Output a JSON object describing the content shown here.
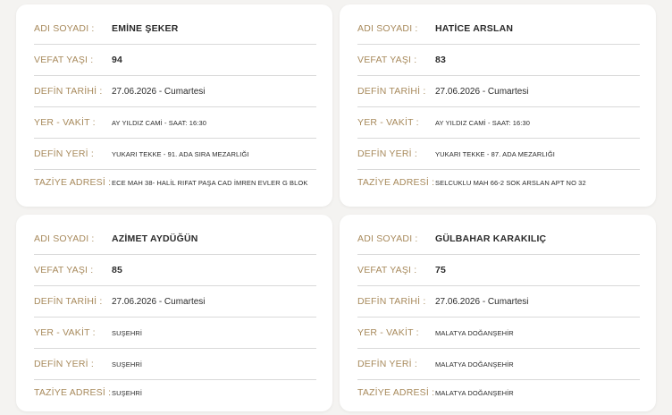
{
  "labels": {
    "name": "ADI SOYADI :",
    "age": "VEFAT YAŞI :",
    "date": "DEFİN TARİHİ :",
    "place_time": "YER - VAKİT :",
    "burial": "DEFİN YERİ :",
    "condolence": "TAZİYE ADRESİ :"
  },
  "cards": [
    {
      "name": "EMİNE ŞEKER",
      "age": "94",
      "date": "27.06.2026 - Cumartesi",
      "place_time": "AY YILDIZ CAMİ - SAAT: 16:30",
      "burial": "YUKARI TEKKE - 91. ADA SIRA MEZARLIĞI",
      "condolence": "ECE MAH 38- HALİL RIFAT PAŞA CAD İMREN EVLER G BLOK"
    },
    {
      "name": "HATİCE ARSLAN",
      "age": "83",
      "date": "27.06.2026 - Cumartesi",
      "place_time": "AY YILDIZ CAMİ - SAAT: 16:30",
      "burial": "YUKARI TEKKE - 87. ADA MEZARLIĞI",
      "condolence": "SELCUKLU MAH 66-2 SOK ARSLAN APT NO 32"
    },
    {
      "name": "AZİMET AYDÜĞÜN",
      "age": "85",
      "date": "27.06.2026 - Cumartesi",
      "place_time": "SUŞEHRİ",
      "burial": "SUŞEHRİ",
      "condolence": "SUŞEHRİ"
    },
    {
      "name": "GÜLBAHAR KARAKILIÇ",
      "age": "75",
      "date": "27.06.2026 - Cumartesi",
      "place_time": "MALATYA DOĞANŞEHİR",
      "burial": "MALATYA DOĞANŞEHİR",
      "condolence": "MALATYA DOĞANŞEHİR"
    }
  ]
}
